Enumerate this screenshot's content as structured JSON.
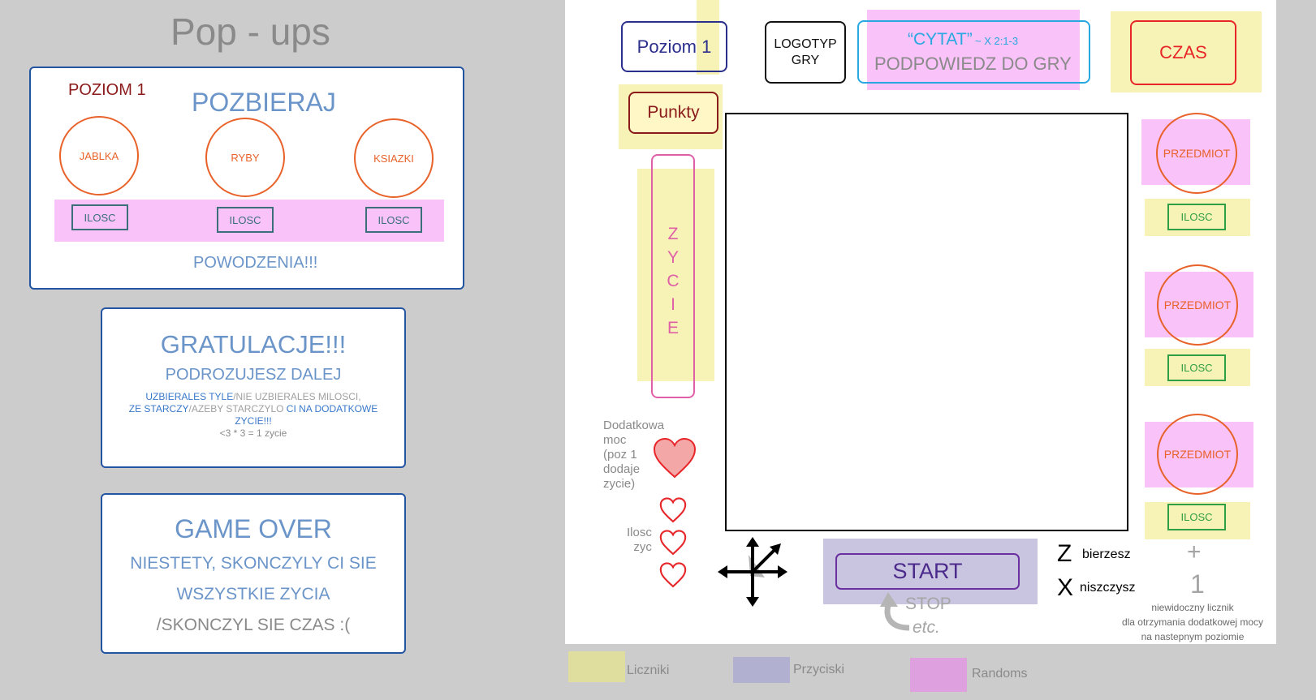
{
  "popups": {
    "title": "Pop - ups",
    "level_popup": {
      "level": "POZIOM 1",
      "heading": "POZBIERAJ",
      "items": [
        "JABLKA",
        "RYBY",
        "KSIAZKI"
      ],
      "counter_label": "ILOSC",
      "footer": "POWODZENIA!!!"
    },
    "congrats_popup": {
      "heading": "GRATULACJE!!!",
      "subheading": "PODROZUJESZ DALEJ",
      "line1_a": "UZBIERALES TYLE",
      "line1_b": "/NIE UZBIERALES MILOSCI,",
      "line2_a": "ZE STARCZY",
      "line2_b": "/AZEBY STARCZYLO ",
      "line2_c": "CI NA DODATKOWE",
      "line3": "ZYCIE!!!",
      "formula": "<3 * 3 = 1 zycie"
    },
    "gameover_popup": {
      "heading": "GAME OVER",
      "line1": "NIESTETY, SKONCZYLY CI SIE",
      "line2": "WSZYSTKIE ZYCIA",
      "line3": "/SKONCZYL SIE CZAS :("
    }
  },
  "game_screen": {
    "level_button": "Poziom 1",
    "logo_line1": "LOGOTYP",
    "logo_line2": "GRY",
    "quote": "“CYTAT”",
    "quote_note": "~ X 2:1-3",
    "hint": "PODPOWIEDZ DO GRY",
    "time": "CZAS",
    "points": "Punkty",
    "life_letters": [
      "Z",
      "Y",
      "C",
      "I",
      "E"
    ],
    "extra_power_label": "Dodatkowa\nmoc\n(poz 1\ndodaje\nzycie)",
    "lives_label": "Ilosc\nzyc",
    "items": [
      {
        "label": "PRZEDMIOT",
        "counter": "ILOSC"
      },
      {
        "label": "PRZEDMIOT",
        "counter": "ILOSC"
      },
      {
        "label": "PRZEDMIOT",
        "counter": "ILOSC"
      }
    ],
    "start": "START",
    "stop": "STOP",
    "etc": "etc.",
    "key_z": "Z",
    "key_z_action": "bierzesz",
    "key_x": "X",
    "key_x_action": "niszczysz",
    "plus": "+",
    "one": "1",
    "counter_note": "niewidoczny licznik\ndla otrzymania dodatkowej mocy\nna nastepnym poziomie"
  },
  "legend": {
    "counters": "Liczniki",
    "buttons": "Przyciski",
    "randoms": "Randoms"
  },
  "colors": {
    "counters": "#f7f3b6",
    "buttons": "#c9c5e0",
    "randoms": "#f9c2f9",
    "popup_border": "#2355a3",
    "orange": "#e8622a"
  }
}
